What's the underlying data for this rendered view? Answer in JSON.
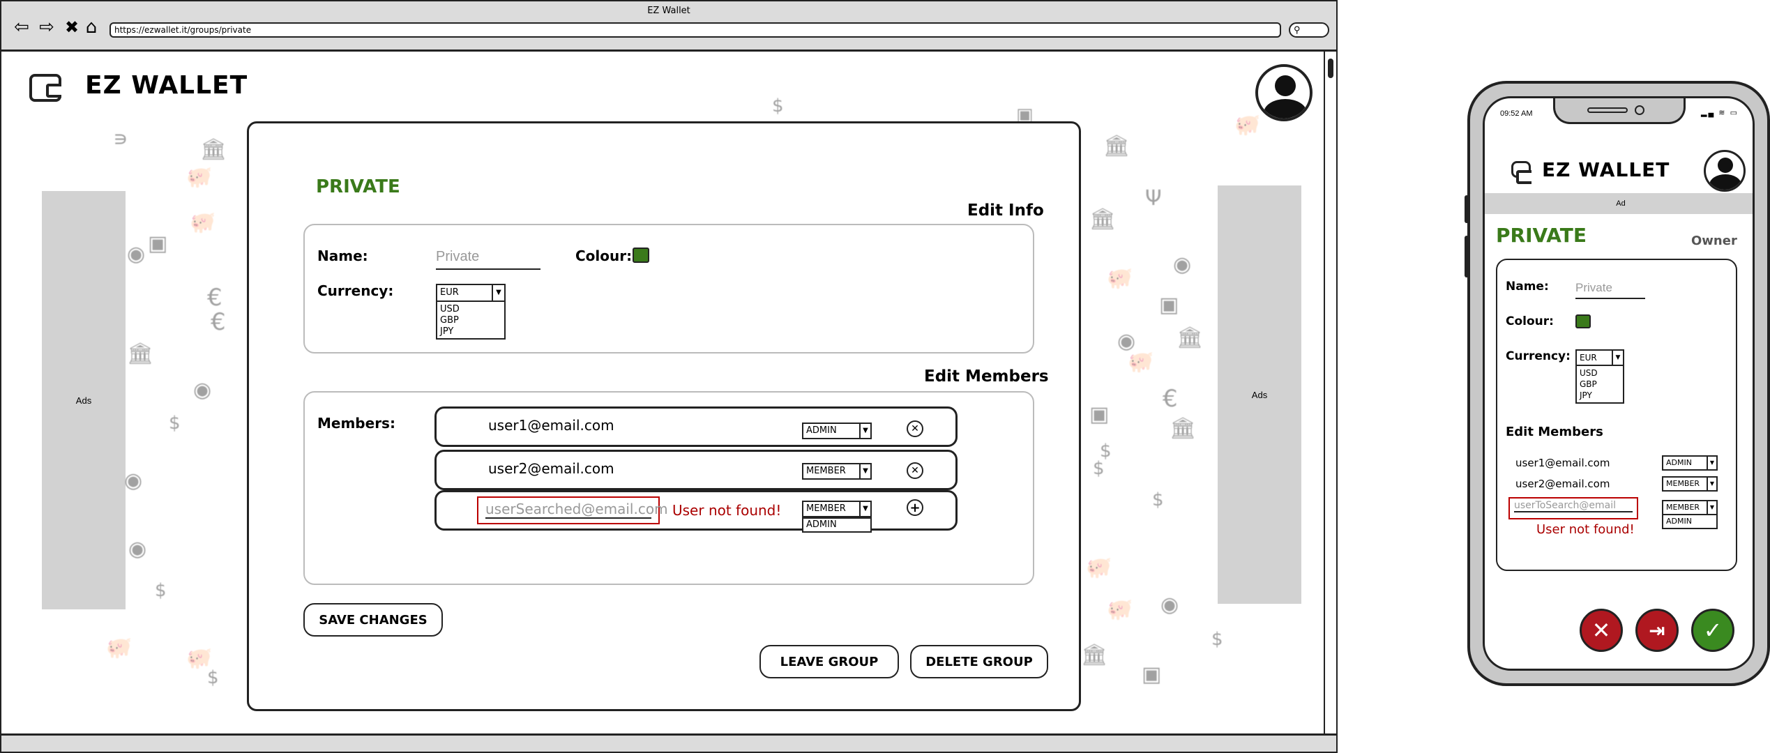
{
  "browser": {
    "window_title": "EZ Wallet",
    "url": "https://ezwallet.it/groups/private"
  },
  "app": {
    "brand": "EZ WALLET",
    "ads_label": "Ads"
  },
  "group": {
    "name_heading": "PRIVATE",
    "edit_info_title": "Edit Info",
    "name_label": "Name:",
    "name_placeholder": "Private",
    "colour_label": "Colour:",
    "colour_value": "#3a7a1a",
    "currency_label": "Currency:",
    "currency_selected": "EUR",
    "currency_options": [
      "USD",
      "GBP",
      "JPY"
    ]
  },
  "members": {
    "section_title": "Edit Members",
    "label": "Members:",
    "rows": [
      {
        "email": "user1@email.com",
        "role": "ADMIN"
      },
      {
        "email": "user2@email.com",
        "role": "MEMBER"
      }
    ],
    "search": {
      "placeholder": "userSearched@email.com",
      "error": "User not found!",
      "role": "MEMBER",
      "role_option": "ADMIN"
    }
  },
  "actions": {
    "save": "SAVE CHANGES",
    "leave": "LEAVE GROUP",
    "delete": "DELETE GROUP"
  },
  "phone": {
    "time": "09:52 AM",
    "brand": "EZ WALLET",
    "ad_label": "Ad",
    "heading": "PRIVATE",
    "role_badge": "Owner",
    "name_label": "Name:",
    "name_placeholder": "Private",
    "colour_label": "Colour:",
    "currency_label": "Currency:",
    "currency_selected": "EUR",
    "currency_options": [
      "USD",
      "GBP",
      "JPY"
    ],
    "members_title": "Edit Members",
    "rows": [
      {
        "email": "user1@email.com",
        "role": "ADMIN"
      },
      {
        "email": "user2@email.com",
        "role": "MEMBER"
      }
    ],
    "search_placeholder": "userToSearch@email",
    "search_role": "MEMBER",
    "search_role_option": "ADMIN",
    "error": "User not found!",
    "colors": {
      "cancel": "#b01820",
      "leave": "#b01820",
      "confirm": "#3a8a20"
    }
  }
}
